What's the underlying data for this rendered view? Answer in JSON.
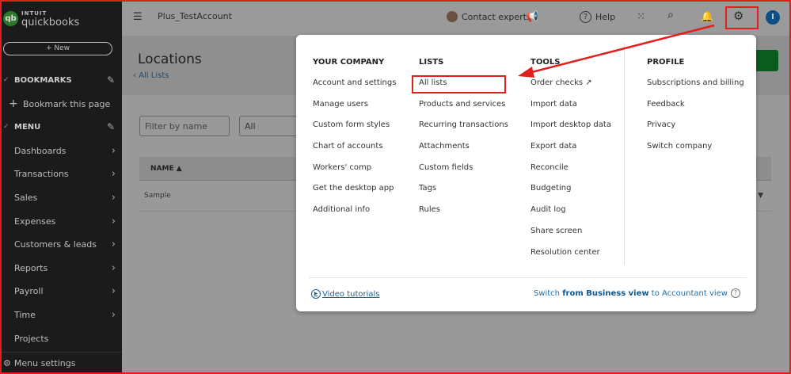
{
  "sidebar": {
    "brand_small": "INTUIT",
    "brand": "quickbooks",
    "new_label": "+ New",
    "bookmarks": "BOOKMARKS",
    "bookmark_page": "Bookmark this page",
    "menu": "MENU",
    "items": [
      {
        "label": "Dashboards"
      },
      {
        "label": "Transactions"
      },
      {
        "label": "Sales"
      },
      {
        "label": "Expenses"
      },
      {
        "label": "Customers & leads"
      },
      {
        "label": "Reports"
      },
      {
        "label": "Payroll"
      },
      {
        "label": "Time"
      },
      {
        "label": "Projects"
      }
    ],
    "menu_settings": "Menu settings"
  },
  "topbar": {
    "company": "Plus_TestAccount",
    "contact": "Contact experts",
    "help": "Help",
    "avatar_initial": "I"
  },
  "page": {
    "title": "Locations",
    "back": "All Lists",
    "filter_placeholder": "Filter by name",
    "status_select": "All",
    "column_name": "NAME",
    "rows": [
      {
        "name": "Sample"
      }
    ]
  },
  "menu": {
    "your_company": {
      "title": "YOUR COMPANY",
      "items": [
        "Account and settings",
        "Manage users",
        "Custom form styles",
        "Chart of accounts",
        "Workers' comp",
        "Get the desktop app",
        "Additional info"
      ]
    },
    "lists": {
      "title": "LISTS",
      "items": [
        "All lists",
        "Products and services",
        "Recurring transactions",
        "Attachments",
        "Custom fields",
        "Tags",
        "Rules"
      ]
    },
    "tools": {
      "title": "TOOLS",
      "items": [
        "Order checks",
        "Import data",
        "Import desktop data",
        "Export data",
        "Reconcile",
        "Budgeting",
        "Audit log",
        "Share screen",
        "Resolution center"
      ]
    },
    "profile": {
      "title": "PROFILE",
      "items": [
        "Subscriptions and billing",
        "Feedback",
        "Privacy",
        "Switch company"
      ]
    },
    "video": "Video tutorials",
    "switch_pre": "Switch ",
    "switch_bold": "from Business view",
    "switch_post": " to Accountant view"
  },
  "colors": {
    "annotation": "#e0201e",
    "link": "#1d6fb0",
    "brand_green": "#2b7a2b"
  }
}
